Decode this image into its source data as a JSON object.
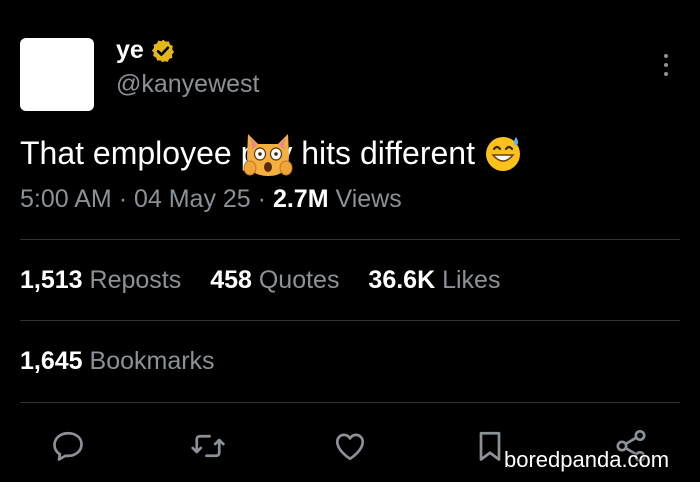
{
  "author": {
    "display_name": "ye",
    "handle": "@kanyewest"
  },
  "tweet": {
    "text_before": "That employee p",
    "text_after": "y hits different",
    "emoji_inline": "weary-cat-face",
    "emoji_end": "grinning-face-with-sweat"
  },
  "meta": {
    "time": "5:00 AM",
    "sep1": "·",
    "date": "04 May 25",
    "sep2": "·",
    "views_count": "2.7M",
    "views_label": "Views"
  },
  "stats": {
    "reposts_count": "1,513",
    "reposts_label": "Reposts",
    "quotes_count": "458",
    "quotes_label": "Quotes",
    "likes_count": "36.6K",
    "likes_label": "Likes",
    "bookmarks_count": "1,645",
    "bookmarks_label": "Bookmarks"
  },
  "actions": {
    "icons": [
      "reply-icon",
      "repost-icon",
      "like-icon",
      "bookmark-icon",
      "share-icon"
    ]
  },
  "watermark": "boredpanda.com",
  "colors": {
    "background": "#000000",
    "primary_text": "#e7e9ea",
    "secondary_text": "#8b9197",
    "verified": "#e2b719",
    "divider": "#2f3336"
  }
}
